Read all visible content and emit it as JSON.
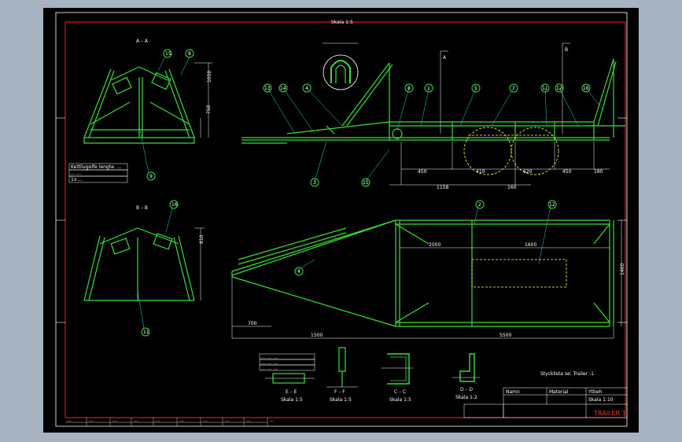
{
  "colors": {
    "frame": "#ff2020",
    "part": "#35e035",
    "dimension": "#ffffff",
    "leader": "#20d8d8",
    "hidden": "#ffff40",
    "background": "#000000",
    "desktop": "#a8b3c1"
  },
  "sections": {
    "aa_title": "A – A",
    "bb_title": "B – B",
    "ee_title": "E – E",
    "ff_title": "F – F",
    "cc_title": "C – C",
    "dd_title": "D – D",
    "detail_title": "Skala 1:5"
  },
  "scales": {
    "e": "Skala 1:5",
    "f": "Skala 1:5",
    "c": "Skala 1:5",
    "d": "Skala 1:2"
  },
  "notes": {
    "left_lines": [
      "Kettlivgolfe lengte: ... ",
      "... ...",
      "1x ..."
    ],
    "e_note_lines": [
      "... ... ...",
      "... ... ...",
      "... ... ..."
    ],
    "product_label": "Stycklista se: Trailer -1"
  },
  "dimensions": {
    "side": [
      "1158",
      "160",
      "450",
      "410",
      "620",
      "450",
      "180",
      "200",
      "1600",
      "240",
      "750"
    ],
    "plan": [
      "1500",
      "1260",
      "2000",
      "1600",
      "5500",
      "700",
      "1400"
    ]
  },
  "balloons": [
    "13",
    "14",
    "4",
    "8",
    "1",
    "5",
    "7",
    "11",
    "12",
    "16",
    "3",
    "9",
    "2",
    "15"
  ],
  "title_block": {
    "drawing_name": "TRAILER 1",
    "rows": [
      "Namn",
      "Material",
      "Ytbeh",
      "Skala 1:10"
    ]
  },
  "bottom_strip": [
    "...",
    "...",
    "...",
    "...",
    "...",
    "...",
    "...",
    "...",
    "...",
    "..."
  ]
}
